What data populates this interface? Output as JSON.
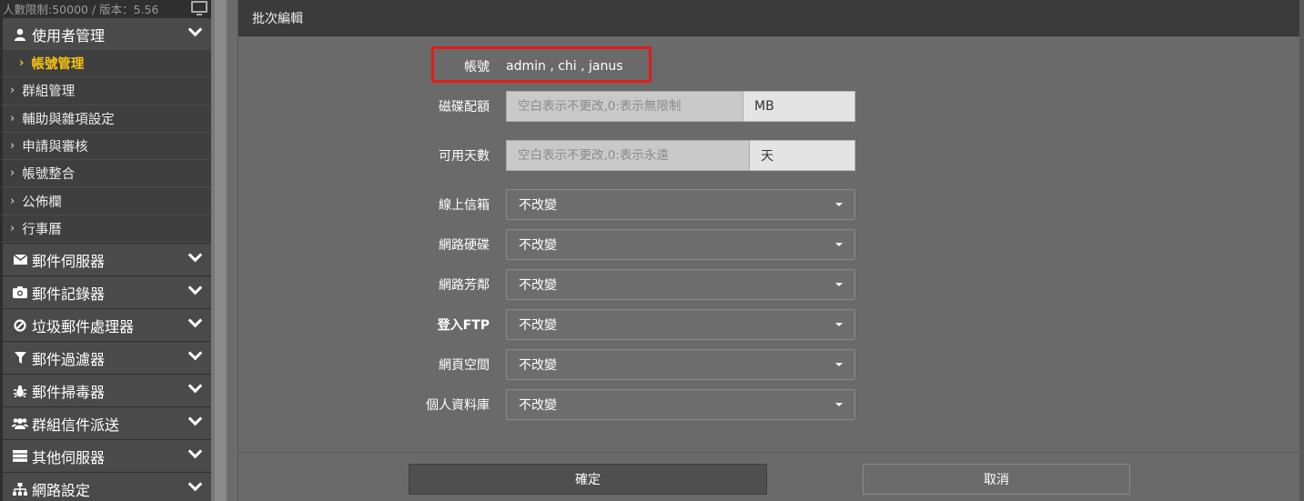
{
  "sidebar": {
    "top_info": "人數限制:50000 / 版本：5.56",
    "user_mgmt": {
      "label": "使用者管理",
      "icon": "user-icon"
    },
    "sub_items": [
      "帳號管理",
      "群組管理",
      "輔助與雜項設定",
      "申請與審核",
      "帳號整合",
      "公佈欄",
      "行事曆"
    ],
    "sections": [
      {
        "label": "郵件伺服器",
        "icon": "envelope-icon"
      },
      {
        "label": "郵件記錄器",
        "icon": "camera-icon"
      },
      {
        "label": "垃圾郵件處理器",
        "icon": "ban-icon"
      },
      {
        "label": "郵件過濾器",
        "icon": "filter-icon"
      },
      {
        "label": "郵件掃毒器",
        "icon": "bug-icon"
      },
      {
        "label": "群組信件派送",
        "icon": "users-icon"
      },
      {
        "label": "其他伺服器",
        "icon": "server-icon"
      },
      {
        "label": "網路設定",
        "icon": "sitemap-icon"
      }
    ]
  },
  "panel": {
    "title": "批次編輯",
    "account": {
      "label": "帳號",
      "value": "admin , chi , janus"
    },
    "quota": {
      "label": "磁碟配額",
      "placeholder": "空白表示不更改,0:表示無限制",
      "unit": "MB"
    },
    "days": {
      "label": "可用天數",
      "placeholder": "空白表示不更改,0:表示永遠",
      "unit": "天"
    },
    "selects": [
      {
        "label": "線上信箱",
        "value": "不改變"
      },
      {
        "label": "網路硬碟",
        "value": "不改變"
      },
      {
        "label": "網路芳鄰",
        "value": "不改變"
      },
      {
        "label": "登入FTP",
        "value": "不改變"
      },
      {
        "label": "網頁空間",
        "value": "不改變"
      },
      {
        "label": "個人資料庫",
        "value": "不改變"
      }
    ],
    "ok_label": "確定",
    "cancel_label": "取消"
  },
  "colors": {
    "highlight": "#e31b1b",
    "active_item": "#f5c211"
  }
}
